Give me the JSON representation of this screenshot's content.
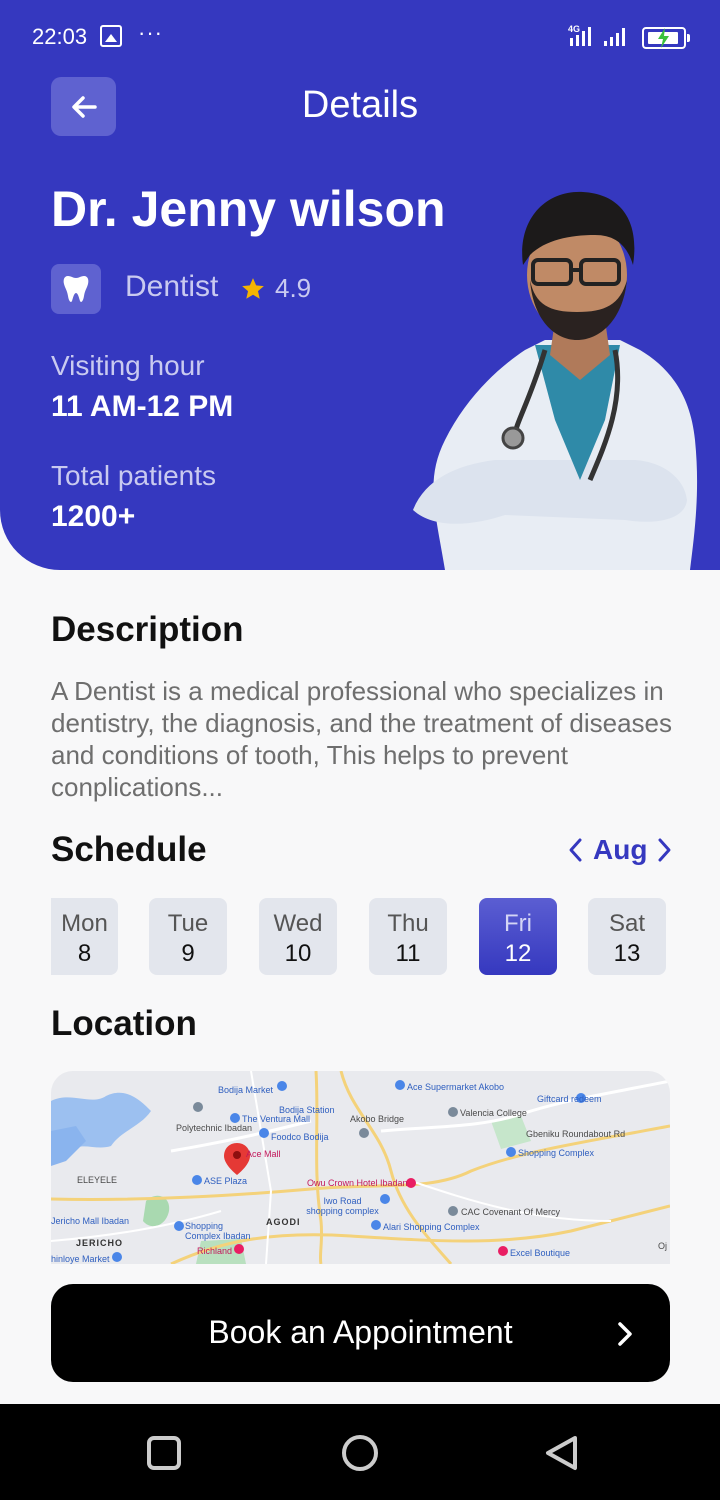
{
  "status_bar": {
    "time": "22:03",
    "dots": "···",
    "network": "4G"
  },
  "header": {
    "title": "Details"
  },
  "doctor": {
    "name": "Dr. Jenny wilson",
    "specialty": "Dentist",
    "rating": "4.9",
    "visiting_hour_label": "Visiting hour",
    "visiting_hour": "11 AM-12 PM",
    "patients_label": "Total patients",
    "patients": "1200+"
  },
  "description": {
    "title": "Description",
    "text": "A Dentist is a medical professional who specializes in dentistry, the diagnosis, and the treatment of diseases and conditions of tooth, This helps to prevent conplications..."
  },
  "schedule": {
    "title": "Schedule",
    "month": "Aug",
    "days": [
      {
        "name": "Mon",
        "num": "8"
      },
      {
        "name": "Tue",
        "num": "9"
      },
      {
        "name": "Wed",
        "num": "10"
      },
      {
        "name": "Thu",
        "num": "11"
      },
      {
        "name": "Fri",
        "num": "12"
      },
      {
        "name": "Sat",
        "num": "13"
      }
    ],
    "selected": "Fri"
  },
  "location": {
    "title": "Location",
    "map_labels": [
      "Bodija Market",
      "Ace Supermarket Akobo",
      "Giftcard redeem",
      "Bodija Station",
      "The Ventura Mall",
      "Akobo Bridge",
      "Valencia College",
      "Polytechnic Ibadan",
      "Foodco Bodija",
      "Ace Mall",
      "Gbeniku Roundabout Rd",
      "Shopping Complex",
      "ELEYELE",
      "ASE Plaza",
      "Owu Crown Hotel Ibadan",
      "Iwo Road shopping complex",
      "CAC Covenant Of Mercy",
      "Jericho Mall Ibadan",
      "Shopping Complex Ibadan",
      "AGODI",
      "Alari Shopping Complex",
      "JERICHO",
      "Richland",
      "Excel Boutique",
      "hinloye Market",
      "Oj"
    ]
  },
  "book_button": {
    "label": "Book an Appointment"
  },
  "colors": {
    "primary": "#3538bf",
    "primary_light": "#5f62d0",
    "star": "#f5b400",
    "button": "#000000"
  },
  "icons": [
    "back-arrow-icon",
    "tooth-icon",
    "star-icon",
    "chevron-left-icon",
    "chevron-right-icon",
    "map-pin-icon"
  ]
}
